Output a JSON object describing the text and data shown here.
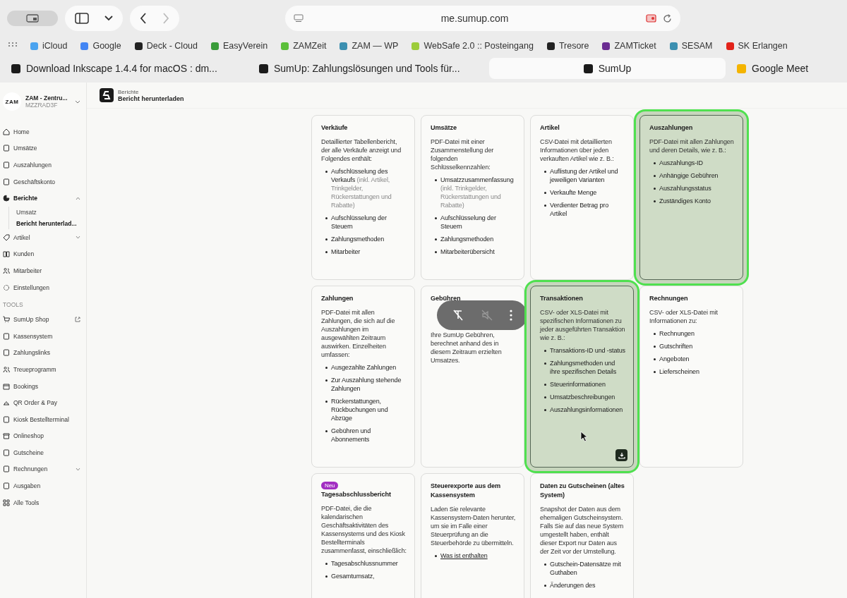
{
  "browser": {
    "url": "me.sumup.com",
    "bookmarks": [
      {
        "label": "iCloud",
        "color": "#4aa3f0"
      },
      {
        "label": "Google",
        "color": "#4285f4"
      },
      {
        "label": "Deck - Cloud",
        "color": "#222222"
      },
      {
        "label": "EasyVerein",
        "color": "#3a9c3a"
      },
      {
        "label": "ZAMZeit",
        "color": "#5bbf3a"
      },
      {
        "label": "ZAM — WP",
        "color": "#3b8fb0"
      },
      {
        "label": "WebSafe 2.0 :: Posteingang",
        "color": "#9ccc3a"
      },
      {
        "label": "Tresore",
        "color": "#222222"
      },
      {
        "label": "ZAMTicket",
        "color": "#6a2c91"
      },
      {
        "label": "SESAM",
        "color": "#3b8fb0"
      },
      {
        "label": "SK Erlangen",
        "color": "#e2231a"
      }
    ],
    "tabs": [
      {
        "title": "Download Inkscape 1.4.4 for macOS : dm...",
        "selected": false
      },
      {
        "title": "SumUp: Zahlungslösungen und Tools für...",
        "selected": false
      },
      {
        "title": "SumUp",
        "selected": true
      },
      {
        "title": "Google Meet",
        "selected": false
      }
    ]
  },
  "sidebar": {
    "account": {
      "logo": "ZAM",
      "name": "ZAM - Zentru...",
      "id": "MZZRAD3F"
    },
    "nav": [
      {
        "label": "Home",
        "selected": false
      },
      {
        "label": "Umsätze",
        "selected": false
      },
      {
        "label": "Auszahlungen",
        "selected": false
      },
      {
        "label": "Geschäftskonto",
        "selected": false
      },
      {
        "label": "Berichte",
        "selected": true,
        "expanded": true,
        "children": [
          {
            "label": "Umsatz",
            "selected": false
          },
          {
            "label": "Bericht herunterlad...",
            "selected": true
          }
        ]
      },
      {
        "label": "Artikel",
        "selected": false,
        "expanded": false
      },
      {
        "label": "Kunden",
        "selected": false
      },
      {
        "label": "Mitarbeiter",
        "selected": false
      },
      {
        "label": "Einstellungen",
        "selected": false
      }
    ],
    "tools_heading": "TOOLS",
    "tools": [
      {
        "label": "SumUp Shop",
        "selected": false,
        "external": true
      },
      {
        "label": "Kassensystem",
        "selected": false
      },
      {
        "label": "Zahlungslinks",
        "selected": false
      },
      {
        "label": "Treueprogramm",
        "selected": false
      },
      {
        "label": "Bookings",
        "selected": false
      },
      {
        "label": "QR Order & Pay",
        "selected": false
      },
      {
        "label": "Kiosk Bestellterminal",
        "selected": false
      },
      {
        "label": "Onlineshop",
        "selected": false
      },
      {
        "label": "Gutscheine",
        "selected": false
      },
      {
        "label": "Rechnungen",
        "selected": false,
        "expanded": false
      },
      {
        "label": "Ausgaben",
        "selected": false
      },
      {
        "label": "Alle Tools",
        "selected": false
      }
    ]
  },
  "header": {
    "section": "Berichte",
    "title": "Bericht herunterladen"
  },
  "cards": [
    {
      "title": "Verkäufe",
      "description": "Detaillierter Tabellenbericht, der alle Verkäufe anzeigt und Folgendes enthält:",
      "highlighted": false,
      "hovered": false,
      "items": [
        {
          "kind": "text",
          "text": "Aufschlüsselung des Verkaufs",
          "note": "(inkl. Artikel, Trinkgelder, Rückerstattungen und Rabatte)"
        },
        {
          "kind": "text",
          "text": "Aufschlüsselung der Steuern"
        },
        {
          "kind": "text",
          "text": "Zahlungsmethoden"
        },
        {
          "kind": "text",
          "text": "Mitarbeiter"
        }
      ]
    },
    {
      "title": "Umsätze",
      "description": "PDF-Datei mit einer Zusammenstellung der folgenden Schlüsselkennzahlen:",
      "highlighted": false,
      "hovered": false,
      "items": [
        {
          "kind": "text",
          "text": "Umsatzzusammenfassung",
          "note": "(inkl. Trinkgelder, Rückerstattungen und Rabatte)"
        },
        {
          "kind": "text",
          "text": "Aufschlüsselung der Steuern"
        },
        {
          "kind": "text",
          "text": "Zahlungsmethoden"
        },
        {
          "kind": "text",
          "text": "Mitarbeiterübersicht"
        }
      ]
    },
    {
      "title": "Artikel",
      "description": "CSV-Datei mit detaillierten Informationen über jeden verkauften Artikel wie z. B.:",
      "highlighted": false,
      "hovered": false,
      "items": [
        {
          "kind": "text",
          "text": "Auflistung der Artikel und jeweiligen Varianten"
        },
        {
          "kind": "text",
          "text": "Verkaufte Menge"
        },
        {
          "kind": "text",
          "text": "Verdienter Betrag pro Artikel"
        }
      ]
    },
    {
      "title": "Auszahlungen",
      "description": "PDF-Datei mit allen Zahlungen und deren Details, wie z. B.:",
      "highlighted": true,
      "hovered": false,
      "items": [
        {
          "kind": "text",
          "text": "Auszahlungs-ID"
        },
        {
          "kind": "text",
          "text": "Anhängige Gebühren"
        },
        {
          "kind": "text",
          "text": "Auszahlungsstatus"
        },
        {
          "kind": "text",
          "text": "Zuständiges Konto"
        }
      ]
    },
    {
      "title": "Zahlungen",
      "description": "PDF-Datei mit allen Zahlungen, die sich auf die Auszahlungen im ausgewählten Zeitraum auswirken. Einzelheiten umfassen:",
      "highlighted": false,
      "hovered": false,
      "items": [
        {
          "kind": "text",
          "text": "Ausgezahlte Zahlungen"
        },
        {
          "kind": "text",
          "text": "Zur Auszahlung stehende Zahlungen"
        },
        {
          "kind": "text",
          "text": "Rückerstattungen, Rückbuchungen und Abzüge"
        },
        {
          "kind": "text",
          "text": "Gebühren und Abonnements"
        }
      ]
    },
    {
      "title": "Gebühren",
      "description": "Ihre SumUp Gebühren, berechnet anhand des in diesem Zeitraum erzielten Umsatzes.",
      "highlighted": false,
      "hovered": false,
      "covered": true
    },
    {
      "title": "Transaktionen",
      "description": "CSV- oder XLS-Datei mit spezifischen Informationen zu jeder ausgeführten Transaktion wie z. B.:",
      "highlighted": true,
      "hovered": true,
      "items": [
        {
          "kind": "text",
          "text": "Transaktions-ID und -status"
        },
        {
          "kind": "text",
          "text": "Zahlungsmethoden und ihre spezifischen Details"
        },
        {
          "kind": "text",
          "text": "Steuerinformationen"
        },
        {
          "kind": "text",
          "text": "Umsatzbeschreibungen"
        },
        {
          "kind": "text",
          "text": "Auszahlungsinformationen"
        }
      ]
    },
    {
      "title": "Rechnungen",
      "description": "CSV- oder XLS-Datei mit Informationen zu:",
      "highlighted": false,
      "hovered": false,
      "items": [
        {
          "kind": "text",
          "text": "Rechnungen"
        },
        {
          "kind": "text",
          "text": "Gutschriften"
        },
        {
          "kind": "text",
          "text": "Angeboten"
        },
        {
          "kind": "text",
          "text": "Lieferscheinen"
        }
      ]
    },
    {
      "title": "Tagesabschlussbericht",
      "badge": "Neu",
      "description": "PDF-Datei, die die kalendarischen Geschäftsaktivitäten des Kassensystems und des Kiosk Bestellterminals zusammenfasst, einschließlich:",
      "highlighted": false,
      "hovered": false,
      "items": [
        {
          "kind": "text",
          "text": "Tagesabschlussnummer"
        },
        {
          "kind": "text",
          "text": "Gesamtumsatz,"
        }
      ]
    },
    {
      "title": "Steuerexporte aus dem Kassensystem",
      "description": "Laden Sie relevante Kassensystem-Daten herunter, um sie im Falle einer Steuerprüfung an die Steuerbehörde zu übermitteln.",
      "highlighted": false,
      "hovered": false,
      "items": [
        {
          "kind": "link",
          "text": "Was ist enthalten"
        }
      ]
    },
    {
      "title": "Daten zu Gutscheinen (altes System)",
      "description": "Snapshot der Daten aus dem ehemaligen Gutscheinsystem. Falls Sie auf das neue System umgestellt haben, enthält dieser Export nur Daten aus der Zeit vor der Umstellung.",
      "highlighted": false,
      "hovered": false,
      "items": [
        {
          "kind": "text",
          "text": "Gutschein-Datensätze mit Guthaben"
        },
        {
          "kind": "text",
          "text": "Änderungen des"
        }
      ]
    }
  ]
}
